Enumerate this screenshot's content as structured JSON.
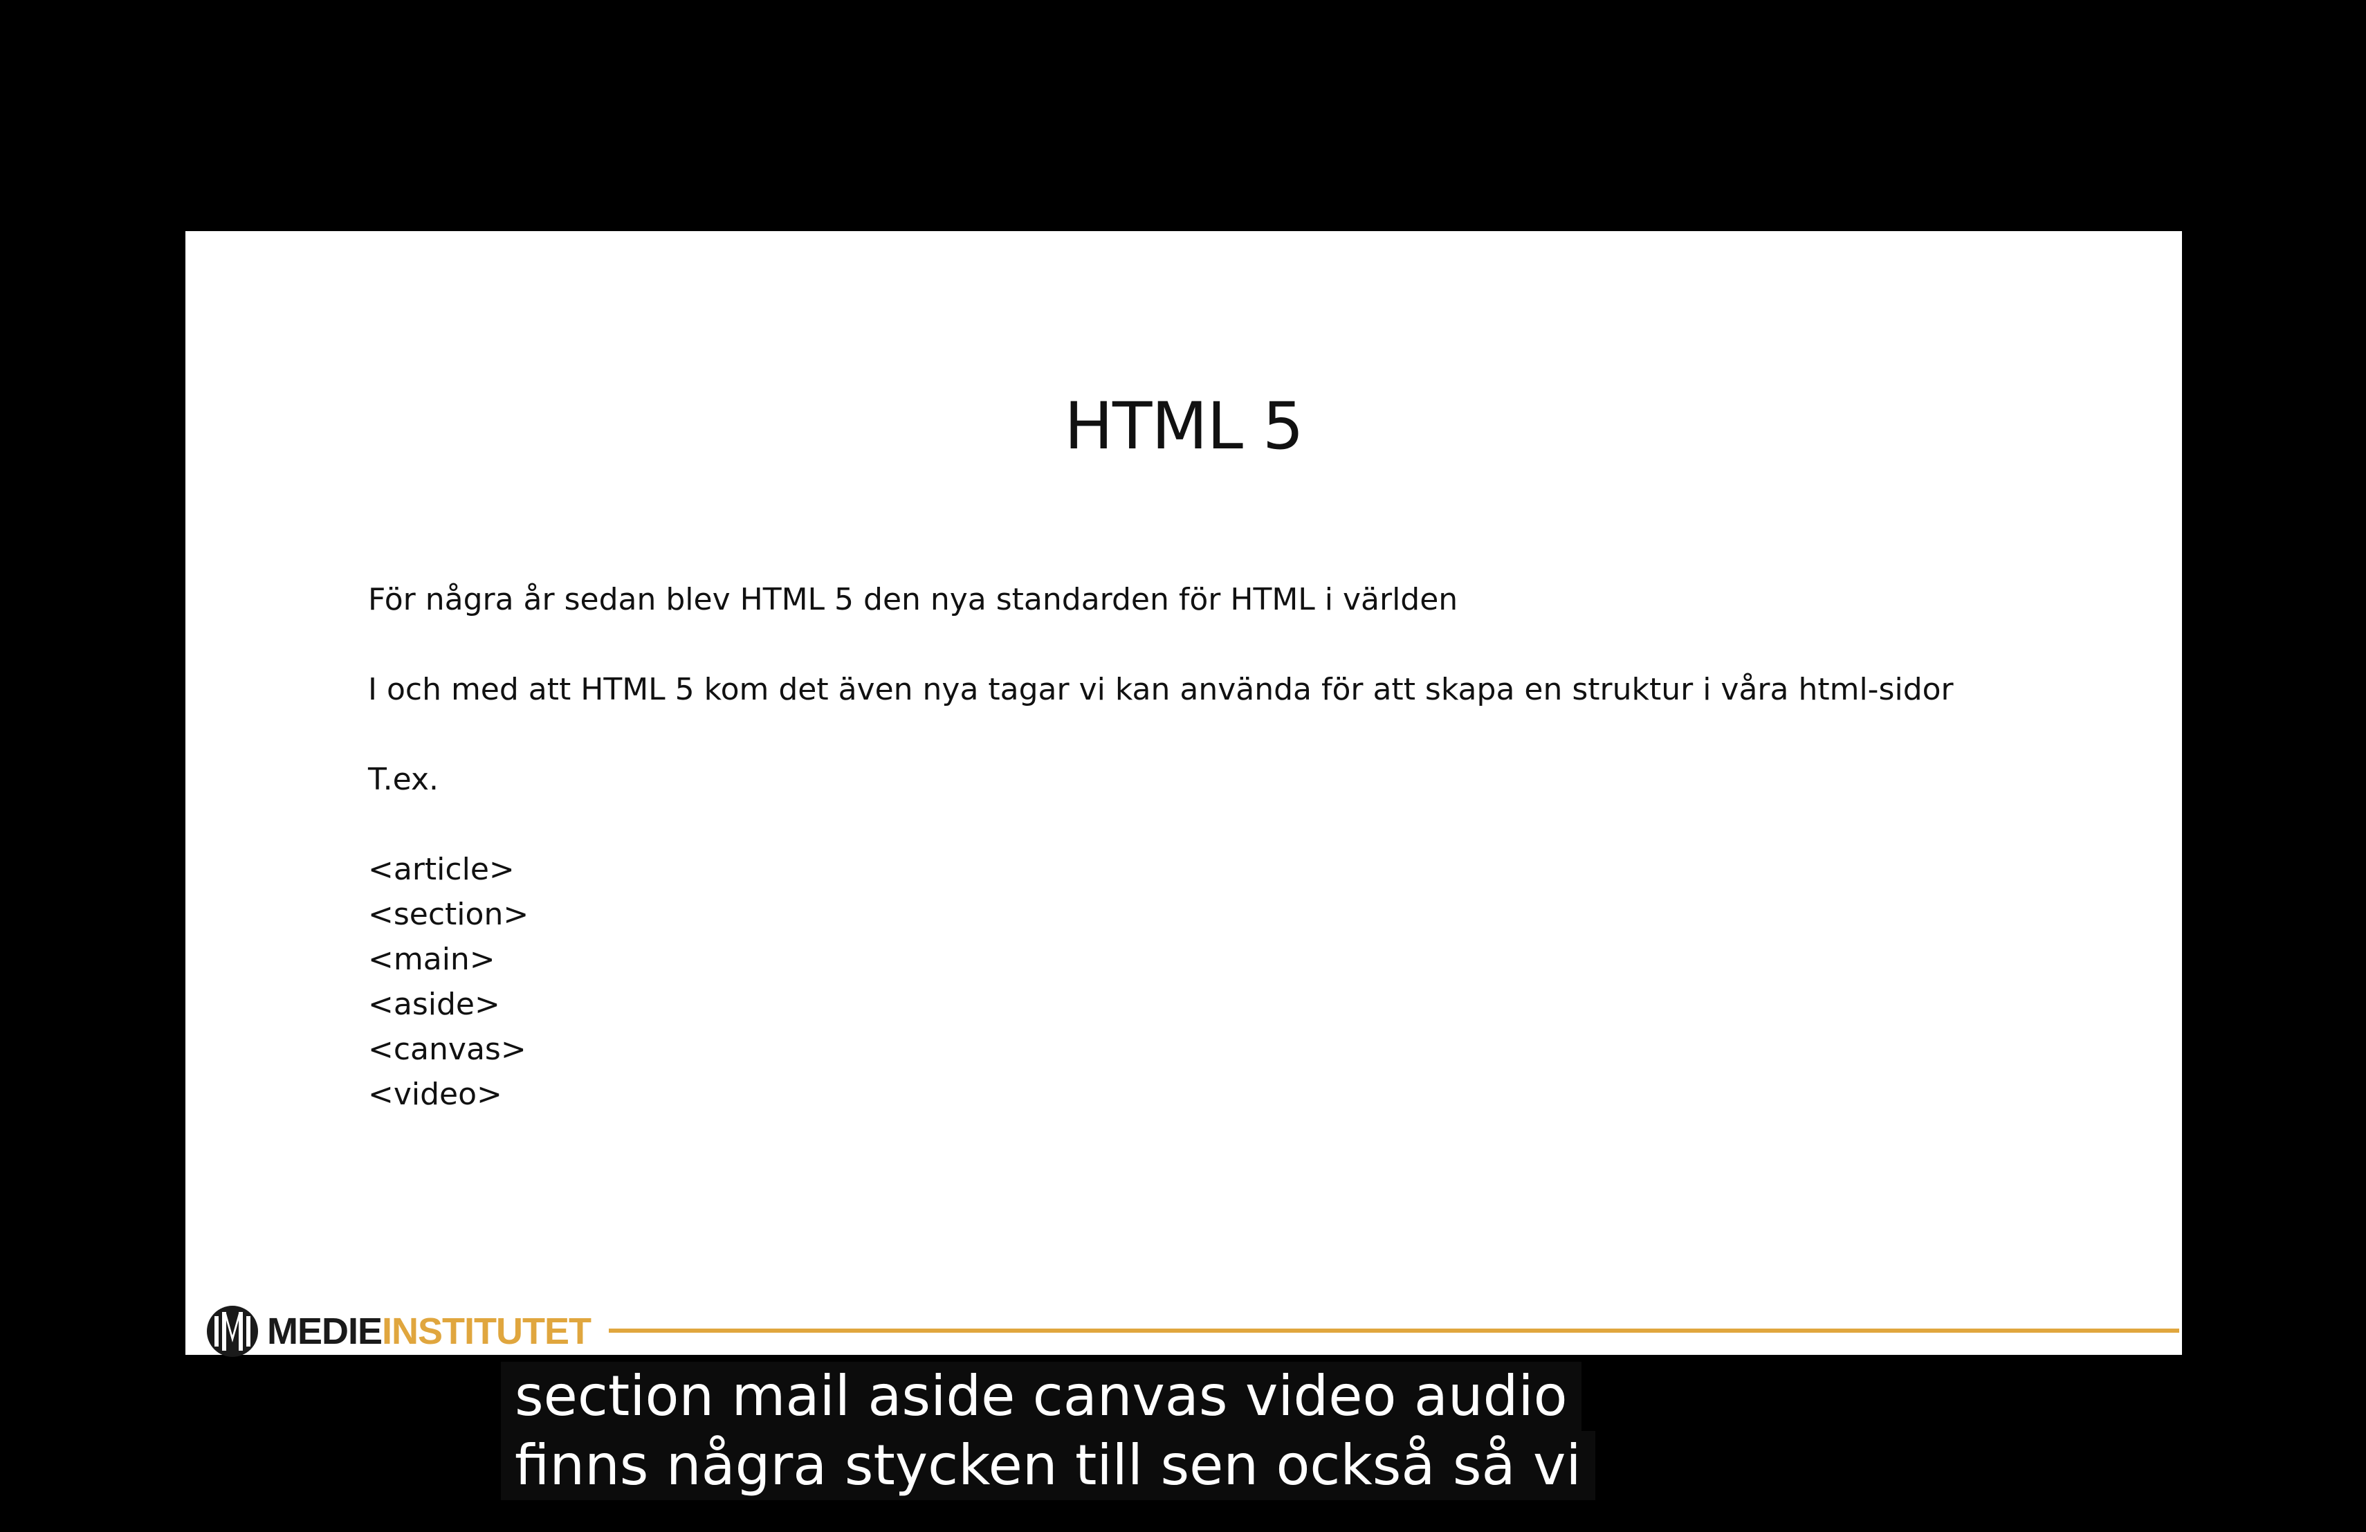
{
  "slide": {
    "title": "HTML 5",
    "paragraphs": [
      "För några år sedan blev HTML 5 den nya standarden för HTML i världen",
      "I och med att HTML 5 kom det även nya tagar vi kan använda för att skapa en struktur i våra html-sidor",
      "T.ex."
    ],
    "tags": [
      "<article>",
      "<section>",
      "<main>",
      "<aside>",
      "<canvas>",
      "<video>"
    ]
  },
  "logo": {
    "part1": "MEDIE",
    "part2": "INSTITUTET",
    "icon": "medieinstitutet-logo-icon"
  },
  "captions": [
    "section mail aside canvas video audio",
    "finns några stycken till sen också så vi"
  ],
  "colors": {
    "background": "#000000",
    "slide": "#ffffff",
    "accent": "#e0a63e",
    "text": "#111111"
  }
}
